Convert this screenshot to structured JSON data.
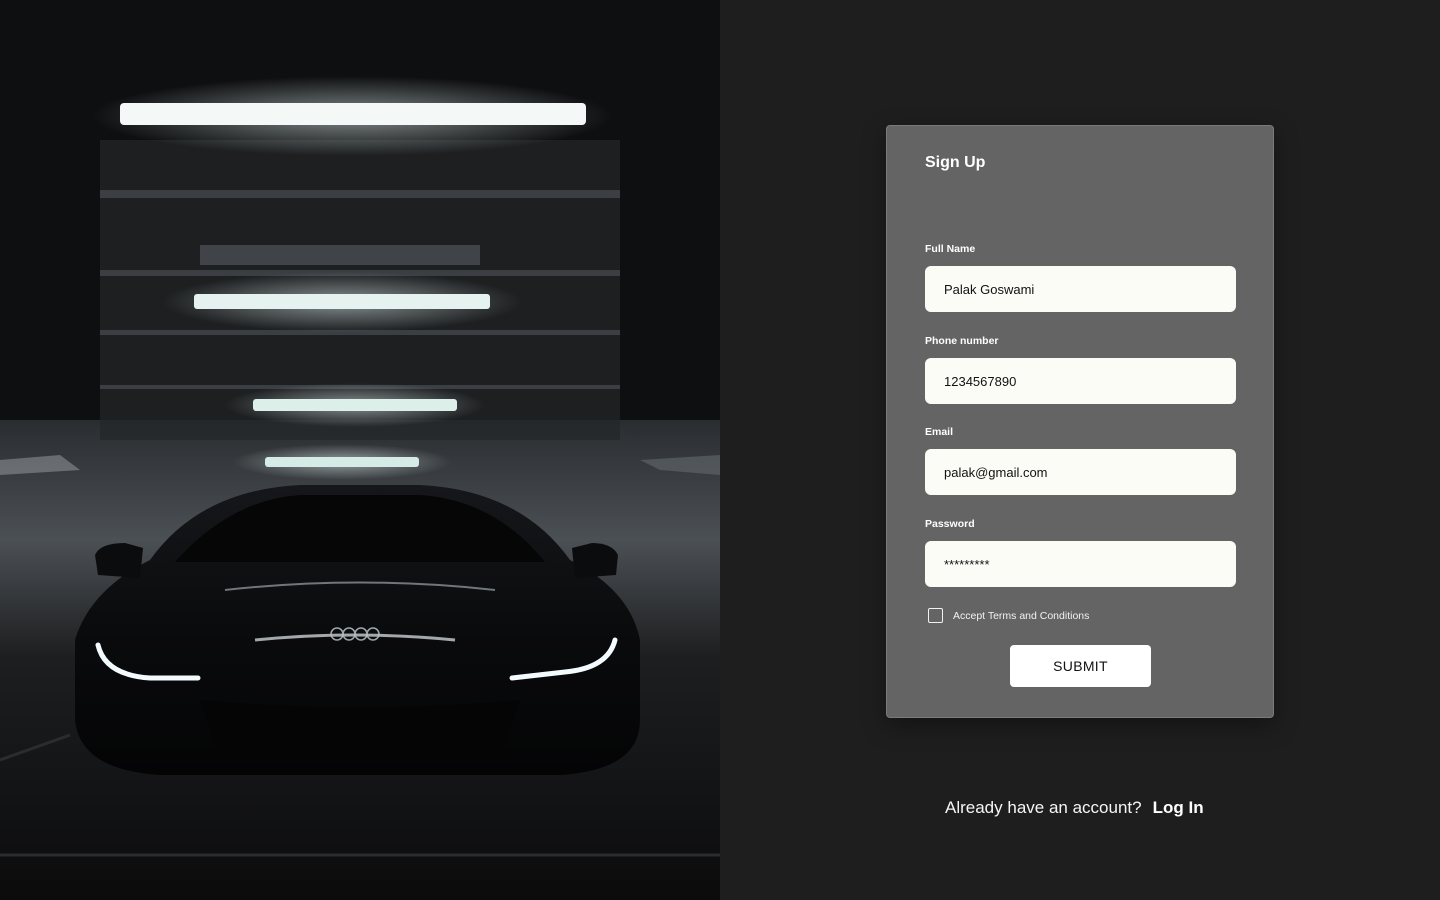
{
  "hero": {
    "image": "car-in-parking-garage"
  },
  "form": {
    "title": "Sign Up",
    "fields": [
      {
        "label": "Full Name",
        "value": "Palak Goswami"
      },
      {
        "label": "Phone number",
        "value": "1234567890"
      },
      {
        "label": "Email",
        "value": "palak@gmail.com"
      },
      {
        "label": "Password",
        "value": "*********"
      }
    ],
    "terms_label": "Accept Terms and Conditions",
    "terms_checked": false,
    "submit_label": "SUBMIT"
  },
  "footer": {
    "question": "Already have an account?",
    "login_label": "Log In"
  },
  "colors": {
    "page_bg": "#1e1e1e",
    "card_bg": "#646464",
    "input_bg": "#fcfcf7",
    "button_bg": "#ffffff"
  }
}
